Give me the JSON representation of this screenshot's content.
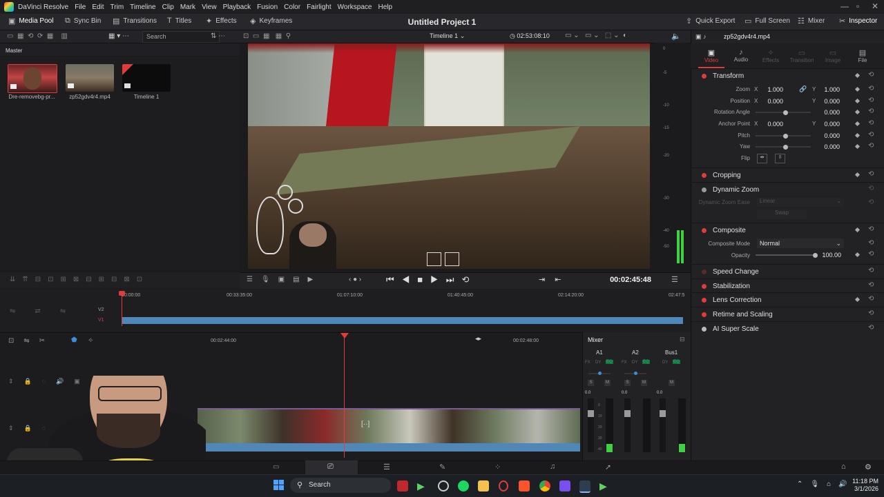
{
  "menubar": {
    "app_name": "DaVinci Resolve",
    "items": [
      "File",
      "Edit",
      "Trim",
      "Timeline",
      "Clip",
      "Mark",
      "View",
      "Playback",
      "Fusion",
      "Color",
      "Fairlight",
      "Workspace",
      "Help"
    ]
  },
  "toolbar": {
    "media_pool": "Media Pool",
    "sync_bin": "Sync Bin",
    "transitions": "Transitions",
    "titles": "Titles",
    "effects": "Effects",
    "keyframes": "Keyframes",
    "project_title": "Untitled Project 1",
    "quick_export": "Quick Export",
    "full_screen": "Full Screen",
    "mixer": "Mixer",
    "inspector": "Inspector"
  },
  "media_pool": {
    "search_placeholder": "Search",
    "bin_name": "Master",
    "clips": [
      {
        "name": "Dre-removebg-pr..."
      },
      {
        "name": "zp52gdv4r4.mp4"
      },
      {
        "name": "Timeline 1"
      }
    ]
  },
  "viewer": {
    "timeline_name": "Timeline 1",
    "source_timecode": "02:53:08:10",
    "timecode": "00:02:45:48"
  },
  "timeline": {
    "ruler_marks": [
      "00:00:00",
      "00:33:35:00",
      "01:07:10:00",
      "01:40:45:00",
      "02:14:20:00",
      "02:47:5"
    ],
    "track_labels": [
      "V2",
      "V1"
    ],
    "detail_ruler": [
      "00:02:44:00",
      "00:02:48:00"
    ]
  },
  "mixer": {
    "title": "Mixer",
    "channels": [
      {
        "name": "A1",
        "fx": "FX",
        "dy": "DY",
        "eq": "EQ",
        "s": "S",
        "m": "M",
        "level": "0.0"
      },
      {
        "name": "A2",
        "fx": "FX",
        "dy": "DY",
        "eq": "EQ",
        "s": "S",
        "m": "M",
        "level": "0.0"
      },
      {
        "name": "Bus1",
        "dy": "DY",
        "eq": "EQ",
        "m": "M",
        "level": "0.0"
      }
    ],
    "scale": [
      "0",
      "10",
      "20",
      "30",
      "40"
    ]
  },
  "audio_meter_scale": [
    "0",
    "-5",
    "-10",
    "-15",
    "-20",
    "-30",
    "-40",
    "-50"
  ],
  "inspector": {
    "clip_name": "zp52gdv4r4.mp4",
    "tabs": [
      "Video",
      "Audio",
      "Effects",
      "Transition",
      "Image",
      "File"
    ],
    "transform": {
      "title": "Transform",
      "zoom_label": "Zoom",
      "zoom_x": "1.000",
      "zoom_y": "1.000",
      "position_label": "Position",
      "position_x": "0.000",
      "position_y": "0.000",
      "rotation_label": "Rotation Angle",
      "rotation": "0.000",
      "anchor_label": "Anchor Point",
      "anchor_x": "0.000",
      "anchor_y": "0.000",
      "pitch_label": "Pitch",
      "pitch": "0.000",
      "yaw_label": "Yaw",
      "yaw": "0.000",
      "flip_label": "Flip",
      "x": "X",
      "y": "Y"
    },
    "cropping": "Cropping",
    "dynamic_zoom": "Dynamic Zoom",
    "dynamic_zoom_ease_label": "Dynamic Zoom Ease",
    "dynamic_zoom_ease": "Linear",
    "swap": "Swap",
    "composite": {
      "title": "Composite",
      "mode_label": "Composite Mode",
      "mode": "Normal",
      "opacity_label": "Opacity",
      "opacity": "100.00"
    },
    "sections": [
      "Speed Change",
      "Stabilization",
      "Lens Correction",
      "Retime and Scaling",
      "AI Super Scale"
    ]
  },
  "taskbar": {
    "search": "Search",
    "time": "11:18 PM",
    "date": "3/1/2026"
  },
  "colors": {
    "accent_red": "#e23b3b",
    "timeline_blue": "#4f87b8",
    "meter_green": "#3fd13f",
    "eq_teal": "#2fa6a6"
  }
}
